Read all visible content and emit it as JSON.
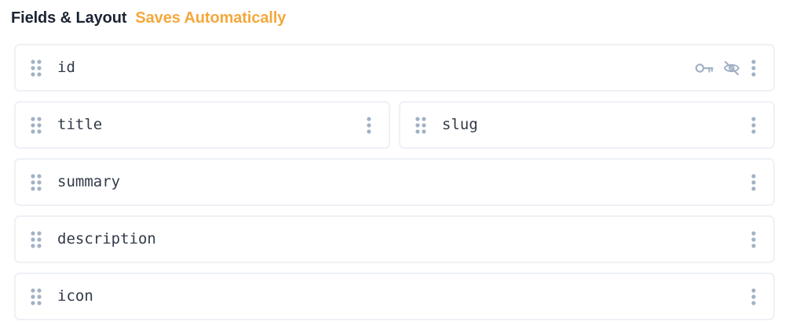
{
  "header": {
    "title": "Fields & Layout",
    "status": "Saves Automatically"
  },
  "colors": {
    "title": "#1c2433",
    "status": "#f4a83c",
    "icon": "#a2b2c5",
    "border": "#eef1f6",
    "field_text": "#323a48"
  },
  "fields": [
    {
      "name": "id",
      "width": "full",
      "icons": [
        "drag-handle-icon",
        "key-icon",
        "eye-off-icon",
        "more-vertical-icon"
      ]
    },
    {
      "name": "title",
      "width": "half",
      "icons": [
        "drag-handle-icon",
        "more-vertical-icon"
      ]
    },
    {
      "name": "slug",
      "width": "half",
      "icons": [
        "drag-handle-icon",
        "more-vertical-icon"
      ]
    },
    {
      "name": "summary",
      "width": "full",
      "icons": [
        "drag-handle-icon",
        "more-vertical-icon"
      ]
    },
    {
      "name": "description",
      "width": "full",
      "icons": [
        "drag-handle-icon",
        "more-vertical-icon"
      ]
    },
    {
      "name": "icon",
      "width": "full",
      "icons": [
        "drag-handle-icon",
        "more-vertical-icon"
      ]
    }
  ]
}
